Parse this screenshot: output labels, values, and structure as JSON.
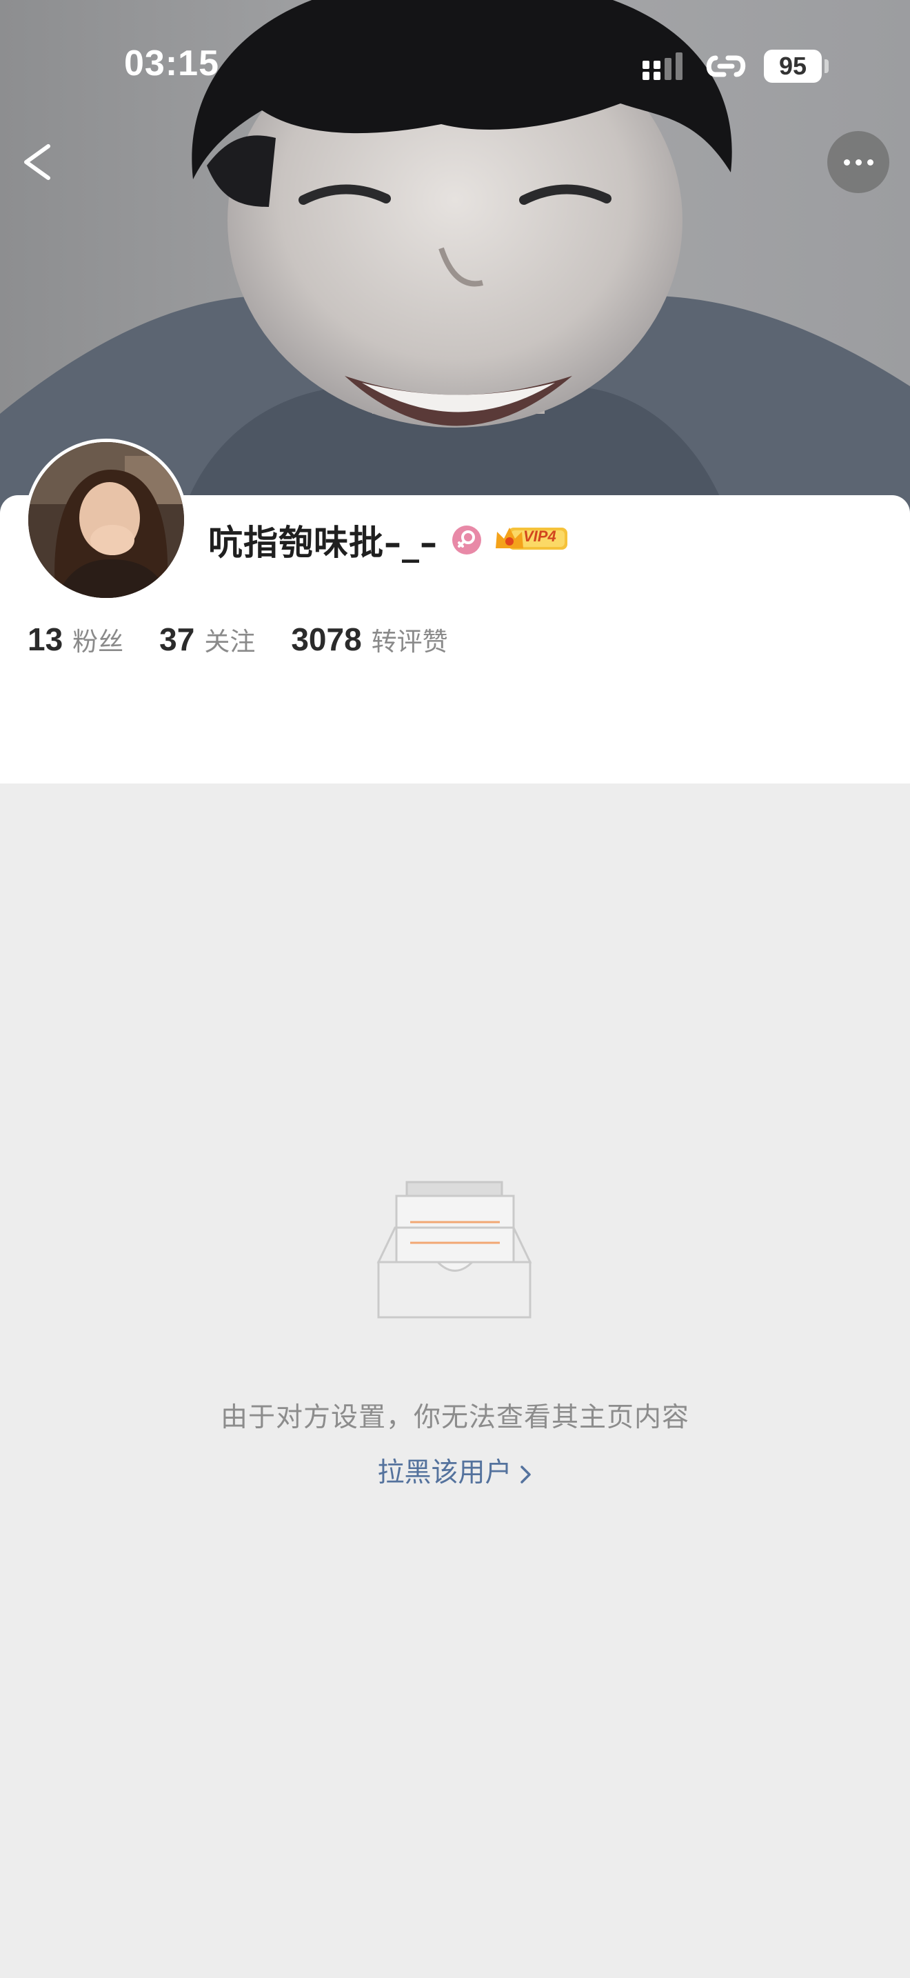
{
  "status_bar": {
    "time": "03:15",
    "battery": "95",
    "icons": [
      "signal-icon",
      "link-icon",
      "battery-icon"
    ]
  },
  "header": {
    "back_icon": "chevron-left-icon",
    "more_icon": "more-dots-icon",
    "cover_image": "cover-photo-smiling-person"
  },
  "profile": {
    "username": "吭指匏味批–_–",
    "gender_icon": "female-gender-icon",
    "vip_label": "VIP4",
    "stats": [
      {
        "value": "13",
        "label": "粉丝"
      },
      {
        "value": "37",
        "label": "关注"
      },
      {
        "value": "3078",
        "label": "转评赞"
      }
    ]
  },
  "empty_state": {
    "illustration": "empty-inbox-icon",
    "message": "由于对方设置，你无法查看其主页内容",
    "block_link": "拉黑该用户"
  },
  "colors": {
    "link": "#54729d",
    "muted_text": "#8c8c8c",
    "background": "#ededed",
    "vip_gold": "#f5b52d"
  }
}
